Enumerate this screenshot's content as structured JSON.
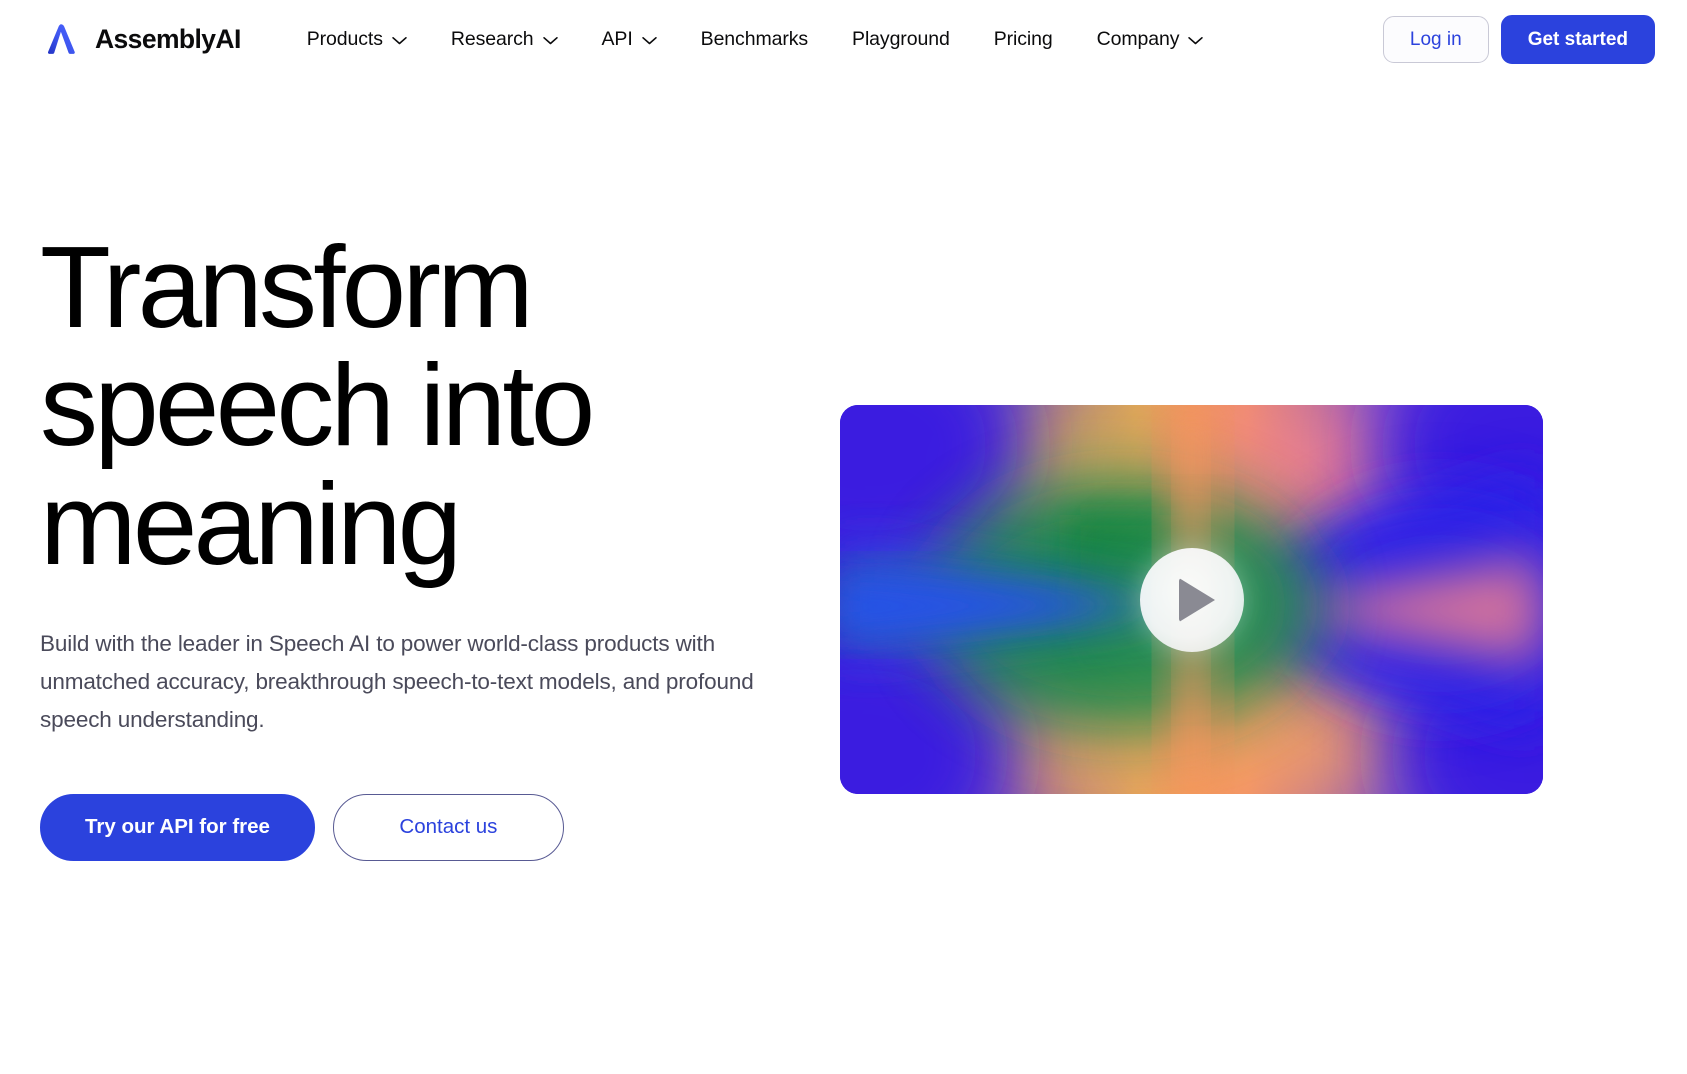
{
  "brand": {
    "name": "AssemblyAI",
    "logo_icon": "lambda-logo-icon",
    "logo_color_start": "#4f6bff",
    "logo_color_end": "#1f2fc9"
  },
  "header": {
    "nav": [
      {
        "label": "Products",
        "has_dropdown": true,
        "icon": "chevron-down-icon"
      },
      {
        "label": "Research",
        "has_dropdown": true,
        "icon": "chevron-down-icon"
      },
      {
        "label": "API",
        "has_dropdown": true,
        "icon": "chevron-down-icon"
      },
      {
        "label": "Benchmarks",
        "has_dropdown": false,
        "icon": ""
      },
      {
        "label": "Playground",
        "has_dropdown": false,
        "icon": ""
      },
      {
        "label": "Pricing",
        "has_dropdown": false,
        "icon": ""
      },
      {
        "label": "Company",
        "has_dropdown": true,
        "icon": "chevron-down-icon"
      }
    ],
    "login_label": "Log in",
    "get_started_label": "Get started"
  },
  "hero": {
    "title": "Transform speech into meaning",
    "title_line_1": "Transform",
    "title_line_2": "speech into",
    "title_line_3": "meaning",
    "subtitle": "Build with the leader in Speech AI to power world-class products with unmatched accuracy, breakthrough speech-to-text models, and profound speech understanding.",
    "primary_cta": "Try our API for free",
    "secondary_cta": "Contact us"
  },
  "video": {
    "play_icon": "play-triangle-icon",
    "alt": "abstract-gradient-video-thumbnail"
  },
  "colors": {
    "accent_blue": "#2b42dd",
    "text_primary": "#000000",
    "text_muted": "#4a4a5a",
    "border_light": "#c9c9d6",
    "page_background": "#ffffff",
    "video_blue": "#3a2ad8",
    "video_orange": "#f2915c",
    "video_green": "#1f8a4c",
    "video_pink": "#f07f8e",
    "video_yellow": "#d9b34f"
  }
}
